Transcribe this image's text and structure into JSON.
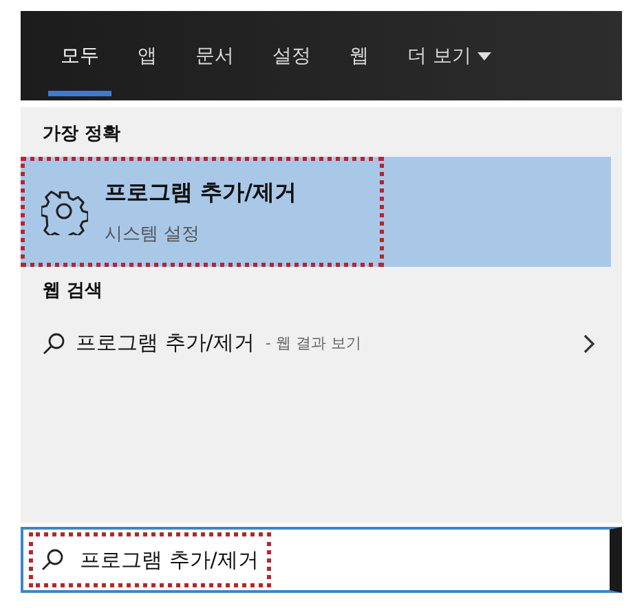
{
  "tabs": [
    {
      "label": "모두",
      "selected": true
    },
    {
      "label": "앱",
      "selected": false
    },
    {
      "label": "문서",
      "selected": false
    },
    {
      "label": "설정",
      "selected": false
    },
    {
      "label": "웹",
      "selected": false
    },
    {
      "label": "더 보기",
      "selected": false,
      "kind": "dropdown"
    }
  ],
  "best_match": {
    "heading": "가장 정확",
    "title": "프로그램 추가/제거",
    "subtitle": "시스템 설정",
    "selected": true,
    "annotated": true
  },
  "web_search": {
    "heading": "웹 검색",
    "query": "프로그램 추가/제거",
    "suffix": "- 웹 결과 보기"
  },
  "search": {
    "value": "프로그램 추가/제거",
    "annotated": true
  }
}
